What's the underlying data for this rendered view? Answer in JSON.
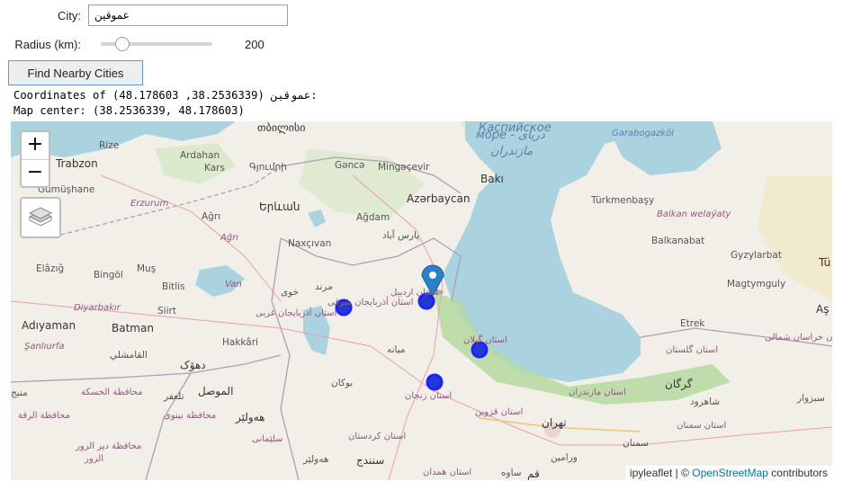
{
  "form": {
    "city_label": "City:",
    "city_value": "عموقین",
    "radius_label": "Radius (km):",
    "radius_value": "200",
    "radius_fraction": 0.15,
    "button_label": "Find Nearby Cities"
  },
  "output": {
    "line1": "Coordinates of (48.178603 ,38.2536339) عموقین:",
    "line2": "Map center: (38.2536339, 48.178603)"
  },
  "map": {
    "zoom_in": "+",
    "zoom_out": "−",
    "layers_icon": "layers-icon",
    "attribution_prefix": "ipyleaflet | © ",
    "attribution_link": "OpenStreetMap",
    "attribution_suffix": " contributors",
    "labels": {
      "tbilisi": "თბილისი",
      "rize": "Rize",
      "trabzon": "Trabzon",
      "gumushane": "Gümüşhane",
      "ardahan": "Ardahan",
      "kars": "Kars",
      "erzurum": "Erzurum",
      "gyumri": "Գյումրի",
      "yerevan": "Երևան",
      "agri": "Ağrı",
      "agri2": "Ağrı",
      "ganca": "Gəncə",
      "mingachevir": "Mingəçevir",
      "azerbaycan": "Azərbaycan",
      "baki": "Bakı",
      "agdam": "Ağdam",
      "nakhchivan": "Naxçıvan",
      "elazig": "Elâzığ",
      "mus": "Muş",
      "bingol": "Bingöl",
      "bitlis": "Bitlis",
      "van": "Van",
      "diyarbakir": "Diyarbakır",
      "siirt": "Siirt",
      "adiyaman": "Adıyaman",
      "batman": "Batman",
      "hakkari": "Hakkâri",
      "sanliurfa": "Şanlıurfa",
      "qamishli": "القامشلي",
      "duhok": "دهۆک",
      "mosul": "الموصل",
      "hewler": "هەولێر",
      "sulaimani": "سلێمانی",
      "marand": "مرند",
      "khoy": "خوی",
      "east_azarbaijan": "استان آذربایجان شرقی",
      "west_azarbaijan": "استان آذربایجان غربی",
      "ardabil": "استان اردبیل",
      "parsabad": "پارس آباد",
      "miyaneh": "میانه",
      "bukan": "بوکان",
      "zanjan": "استان زنجان",
      "gilan": "استان گیلان",
      "qazvin": "استان قزوین",
      "kurdistan": "استان کردستان",
      "sanandaj": "سنندج",
      "tehran": "تهران",
      "mazandaran": "استان مازندران",
      "golestan": "استان گلستان",
      "gorgan": "گرگان",
      "shahroud": "شاهرود",
      "semnan_prov": "استان سمنان",
      "semnan": "سمنان",
      "sabzevar": "سبزوار",
      "khorasan": "استان خراسان شمالی",
      "turkmenbasy": "Türkmenbaşy",
      "balkan": "Balkan welaýaty",
      "balkanabat": "Balkanabat",
      "gyzylarbat": "Gyzylarbat",
      "magtymguly": "Magtymguly",
      "etrek": "Etrek",
      "garabogaz": "Garabogazköl",
      "caspian_ru": "море - دریای",
      "caspian_fa": "مازندران",
      "caspian_top": "Каспийское",
      "hasakah": "محافظة الحسكة",
      "raqqa": "محافظة الرقة",
      "nineveh": "محافظة نينوى",
      "talafar": "تلعفر",
      "mayadin": "محافظة دير الزور",
      "zor": "الزور",
      "sinjar": "منبج",
      "kirkuk": "هەولێر",
      "hamadan": "استان همدان",
      "qom": "قم",
      "saveh": "ساوه",
      "varamin": "ورامین",
      "tu": "Tü",
      "as": "Aş"
    }
  }
}
